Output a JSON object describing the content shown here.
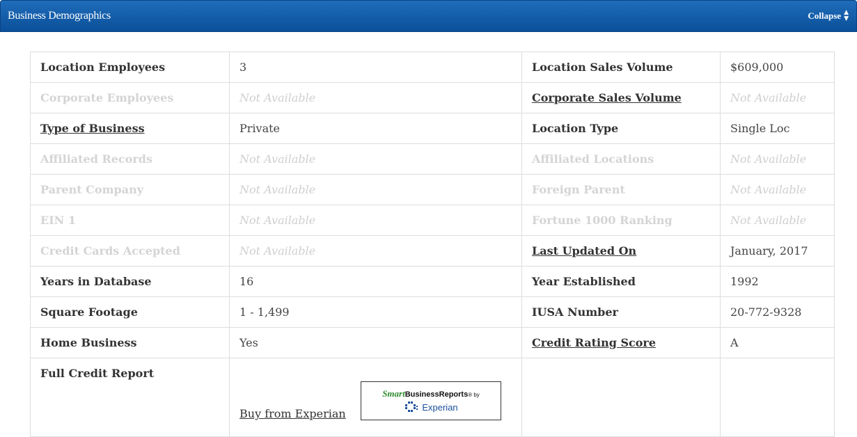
{
  "panel": {
    "title": "Business Demographics",
    "collapse_label": "Collapse",
    "collapse_icon": "sort-arrows-icon"
  },
  "rows": [
    {
      "l1": "Location Employees",
      "v1": "3",
      "l2": "Location Sales Volume",
      "v2": "$609,000"
    },
    {
      "l1": "Corporate Employees",
      "v1": "Not Available",
      "l2": "Corporate Sales Volume",
      "v2": "Not Available"
    },
    {
      "l1": "Type of Business",
      "v1": "Private",
      "l2": "Location Type",
      "v2": "Single Loc"
    },
    {
      "l1": "Affiliated Records",
      "v1": "Not Available",
      "l2": "Affiliated Locations",
      "v2": "Not Available"
    },
    {
      "l1": "Parent Company",
      "v1": "Not Available",
      "l2": "Foreign Parent",
      "v2": "Not Available"
    },
    {
      "l1": "EIN 1",
      "v1": "Not Available",
      "l2": "Fortune 1000 Ranking",
      "v2": "Not Available"
    },
    {
      "l1": "Credit Cards Accepted",
      "v1": "Not Available",
      "l2": "Last Updated On",
      "v2": "January, 2017"
    },
    {
      "l1": "Years in Database",
      "v1": "16",
      "l2": "Year Established",
      "v2": "1992"
    },
    {
      "l1": "Square Footage",
      "v1": "1 - 1,499",
      "l2": "IUSA Number",
      "v2": "20-772-9328"
    },
    {
      "l1": "Home Business",
      "v1": "Yes",
      "l2": "Credit Rating Score",
      "v2": "A"
    }
  ],
  "credit_report": {
    "label": "Full Credit Report",
    "buy_link": "Buy from Experian",
    "badge_smart": "Smart",
    "badge_reports": "BusinessReports",
    "badge_by": "® by",
    "badge_experian": "Experian",
    "badge_icon": "experian-logo-icon"
  },
  "colors": {
    "header_top": "#1f6dbb",
    "header_bottom": "#0b4f99",
    "muted_text": "#d4d4d4",
    "border": "#dddddd"
  }
}
